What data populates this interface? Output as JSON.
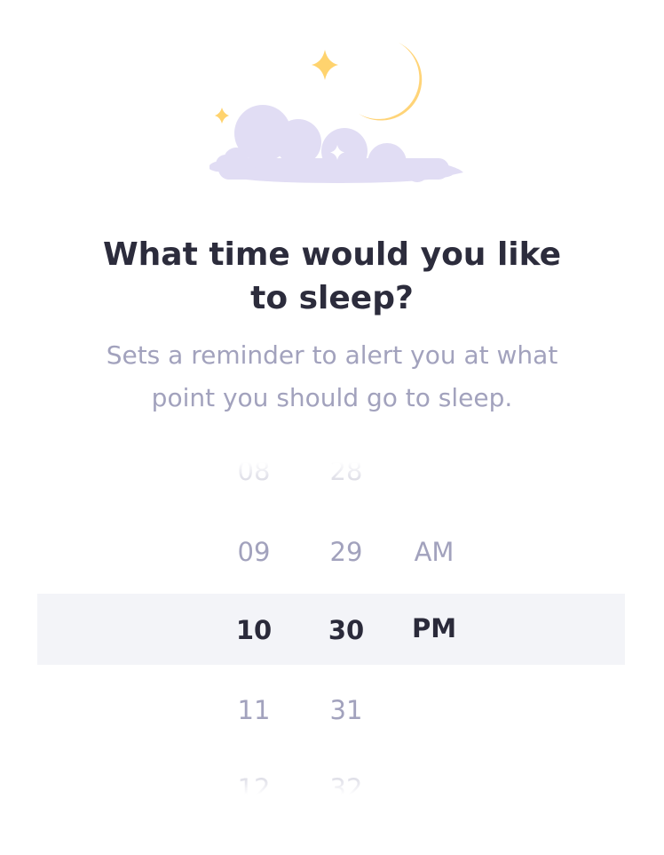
{
  "heading": {
    "line1": "What time would you like",
    "line2": "to sleep?"
  },
  "description": {
    "line1": "Sets a reminder to alert you at what",
    "line2": "point you should go to sleep."
  },
  "picker": {
    "hours": [
      "08",
      "09",
      "10",
      "11",
      "12"
    ],
    "minutes": [
      "28",
      "29",
      "30",
      "31",
      "32"
    ],
    "periods": [
      "AM",
      "PM"
    ],
    "selected_hour": "10",
    "selected_minute": "30",
    "selected_period": "PM"
  },
  "colors": {
    "moon": "#ffd478",
    "star": "#ffd36e",
    "cloud": "#e1ddf4",
    "highlight": "#f3f4f8",
    "title": "#2c2c3c",
    "muted": "#a2a2bd"
  },
  "icons": [
    "moon-icon",
    "star-icon",
    "cloud-icon"
  ]
}
